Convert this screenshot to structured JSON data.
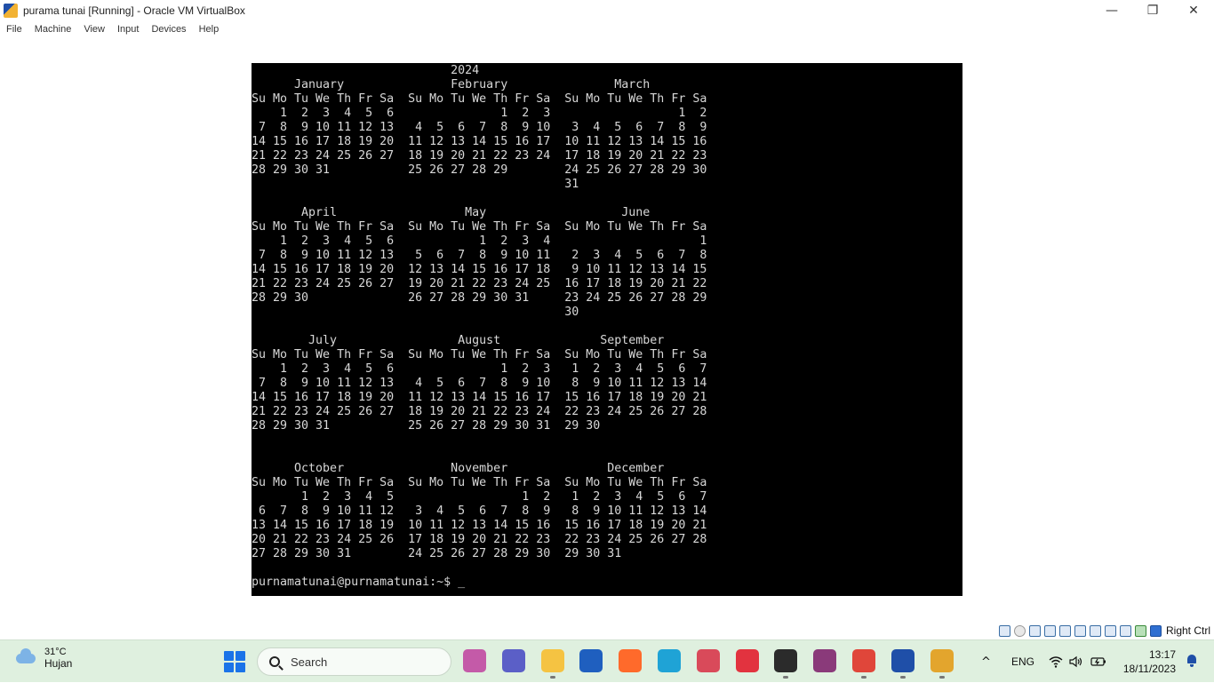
{
  "window": {
    "title": "purama tunai [Running] - Oracle VM VirtualBox",
    "icon": "virtualbox-icon",
    "controls": {
      "minimize": "—",
      "restore": "❐",
      "close": "✕"
    }
  },
  "menubar": {
    "items": [
      "File",
      "Machine",
      "View",
      "Input",
      "Devices",
      "Help"
    ]
  },
  "terminal": {
    "lines": [
      "                            2024",
      "      January               February               March",
      "Su Mo Tu We Th Fr Sa  Su Mo Tu We Th Fr Sa  Su Mo Tu We Th Fr Sa",
      "    1  2  3  4  5  6               1  2  3                  1  2",
      " 7  8  9 10 11 12 13   4  5  6  7  8  9 10   3  4  5  6  7  8  9",
      "14 15 16 17 18 19 20  11 12 13 14 15 16 17  10 11 12 13 14 15 16",
      "21 22 23 24 25 26 27  18 19 20 21 22 23 24  17 18 19 20 21 22 23",
      "28 29 30 31           25 26 27 28 29        24 25 26 27 28 29 30",
      "                                            31",
      "",
      "       April                  May                   June",
      "Su Mo Tu We Th Fr Sa  Su Mo Tu We Th Fr Sa  Su Mo Tu We Th Fr Sa",
      "    1  2  3  4  5  6            1  2  3  4                     1",
      " 7  8  9 10 11 12 13   5  6  7  8  9 10 11   2  3  4  5  6  7  8",
      "14 15 16 17 18 19 20  12 13 14 15 16 17 18   9 10 11 12 13 14 15",
      "21 22 23 24 25 26 27  19 20 21 22 23 24 25  16 17 18 19 20 21 22",
      "28 29 30              26 27 28 29 30 31     23 24 25 26 27 28 29",
      "                                            30",
      "",
      "        July                 August              September",
      "Su Mo Tu We Th Fr Sa  Su Mo Tu We Th Fr Sa  Su Mo Tu We Th Fr Sa",
      "    1  2  3  4  5  6               1  2  3   1  2  3  4  5  6  7",
      " 7  8  9 10 11 12 13   4  5  6  7  8  9 10   8  9 10 11 12 13 14",
      "14 15 16 17 18 19 20  11 12 13 14 15 16 17  15 16 17 18 19 20 21",
      "21 22 23 24 25 26 27  18 19 20 21 22 23 24  22 23 24 25 26 27 28",
      "28 29 30 31           25 26 27 28 29 30 31  29 30",
      "",
      "",
      "      October               November              December",
      "Su Mo Tu We Th Fr Sa  Su Mo Tu We Th Fr Sa  Su Mo Tu We Th Fr Sa",
      "       1  2  3  4  5                  1  2   1  2  3  4  5  6  7",
      " 6  7  8  9 10 11 12   3  4  5  6  7  8  9   8  9 10 11 12 13 14",
      "13 14 15 16 17 18 19  10 11 12 13 14 15 16  15 16 17 18 19 20 21",
      "20 21 22 23 24 25 26  17 18 19 20 21 22 23  22 23 24 25 26 27 28",
      "27 28 29 30 31        24 25 26 27 28 29 30  29 30 31",
      "",
      "purnamatunai@purnamatunai:~$ _"
    ]
  },
  "vm_status": {
    "icons": [
      "hard-disk-icon",
      "optical-disk-icon",
      "audio-icon",
      "network-icon",
      "usb-icon",
      "shared-folder-icon",
      "display-icon",
      "video-capture-icon",
      "cpu-icon",
      "mouse-integration-icon",
      "keyboard-icon"
    ],
    "host_key": "Right Ctrl"
  },
  "taskbar": {
    "weather": {
      "temp": "31°C",
      "desc": "Hujan"
    },
    "search_placeholder": "Search",
    "apps": [
      {
        "name": "copilot-icon",
        "color": "#c45aa8"
      },
      {
        "name": "teams-icon",
        "color": "#5b5fc7"
      },
      {
        "name": "file-explorer-icon",
        "color": "#f5c342"
      },
      {
        "name": "vpn-icon",
        "color": "#1f5fbf"
      },
      {
        "name": "firefox-icon",
        "color": "#ff6a2b"
      },
      {
        "name": "edge-icon",
        "color": "#1fa3d6"
      },
      {
        "name": "snipping-tool-icon",
        "color": "#d94a5a"
      },
      {
        "name": "wps-icon",
        "color": "#e2333f"
      },
      {
        "name": "terminal-icon",
        "color": "#2b2b2b"
      },
      {
        "name": "winrar-icon",
        "color": "#8a3a7a"
      },
      {
        "name": "chrome-icon",
        "color": "#e0463a"
      },
      {
        "name": "virtualbox-icon",
        "color": "#1f4fa8"
      },
      {
        "name": "virtualbox-running-icon",
        "color": "#e3a52d"
      }
    ],
    "tray": {
      "chevron": "^",
      "language": "ENG",
      "wifi": "wifi-icon",
      "volume": "volume-icon",
      "battery": "battery-icon"
    },
    "clock": {
      "time": "13:17",
      "date": "18/11/2023"
    }
  }
}
